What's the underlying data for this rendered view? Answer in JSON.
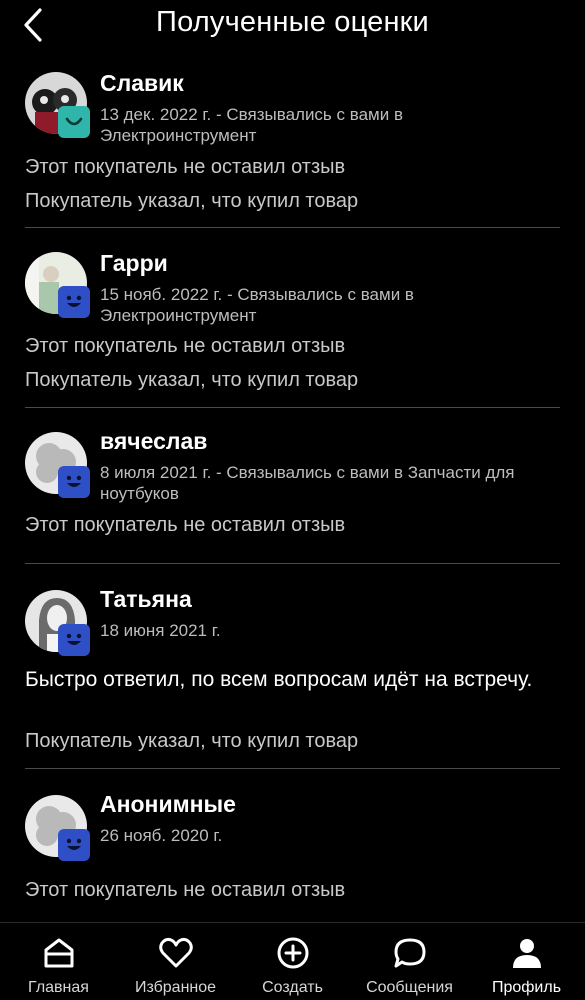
{
  "header": {
    "title": "Полученные оценки"
  },
  "reviews": [
    {
      "name": "Славик",
      "meta": "13 дек. 2022 г. - Связывались с вами в Электроинструмент",
      "line1": "Этот покупатель не оставил отзыв",
      "line2": "Покупатель указал, что купил товар",
      "badge_color": "#2fb5a9"
    },
    {
      "name": "Гарри",
      "meta": "15 нояб. 2022 г. - Связывались с вами в Электроинструмент",
      "line1": "Этот покупатель не оставил отзыв",
      "line2": "Покупатель указал, что купил товар",
      "badge_color": "#2f4fc7"
    },
    {
      "name": "вячеслав",
      "meta": "8 июля 2021 г. - Связывались с вами в Запчасти для ноутбуков",
      "line1": "Этот покупатель не оставил отзыв",
      "badge_color": "#2f4fc7"
    },
    {
      "name": "Татьяна",
      "meta": "18 июня 2021 г.",
      "comment": "Быстро ответил,  по всем вопросам идёт на встречу.",
      "line2": "Покупатель указал, что купил товар",
      "badge_color": "#2f4fc7"
    },
    {
      "name": "Анонимные",
      "meta": "26 нояб. 2020 г.",
      "line1": "Этот покупатель не оставил отзыв",
      "badge_color": "#2f4fc7"
    }
  ],
  "tabbar": {
    "home": "Главная",
    "favorites": "Избранное",
    "create": "Создать",
    "messages": "Сообщения",
    "profile": "Профиль"
  }
}
